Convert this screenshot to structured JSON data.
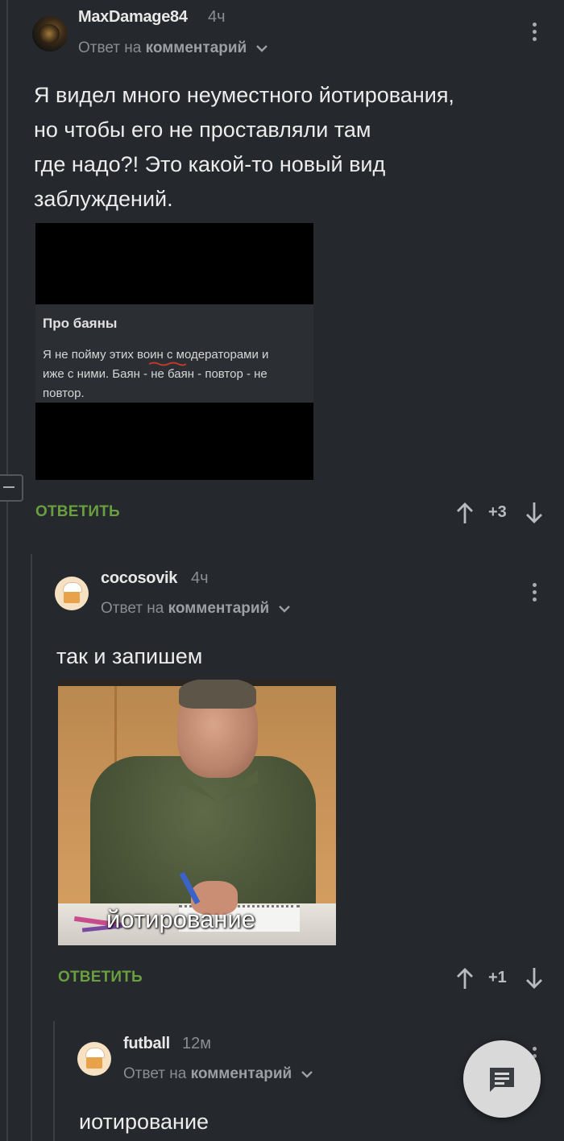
{
  "comments": [
    {
      "username": "MaxDamage84",
      "time": "4ч",
      "reply_prefix": "Ответ на",
      "reply_target": "комментарий",
      "text_lines": [
        "Я видел много неуместного йотирования,",
        "но чтобы его не проставляли там",
        "где надо?! Это какой-то новый вид",
        "заблуждений."
      ],
      "quoted_post": {
        "title": "Про баяны",
        "body_lines": [
          "Я не пойму этих воин с модераторами и",
          "иже с ними. Баян - не баян - повтор - не",
          "повтор."
        ]
      },
      "reply_label": "ОТВЕТИТЬ",
      "score": "+3"
    },
    {
      "username": "cocosovik",
      "time": "4ч",
      "reply_prefix": "Ответ на",
      "reply_target": "комментарий",
      "text": "так и запишем",
      "image_caption": "йотирование",
      "reply_label": "ОТВЕТИТЬ",
      "score": "+1"
    },
    {
      "username": "futball",
      "time": "12м",
      "reply_prefix": "Ответ на",
      "reply_target": "комментарий",
      "text": "иотирование"
    }
  ],
  "icons": {
    "upvote": "arrow-up-icon",
    "downvote": "arrow-down-icon",
    "menu": "more-vertical-icon",
    "collapse": "minus-icon",
    "fab": "chat-icon"
  },
  "colors": {
    "background": "#25282c",
    "accent": "#6a9f40",
    "muted": "#8a8d91"
  }
}
